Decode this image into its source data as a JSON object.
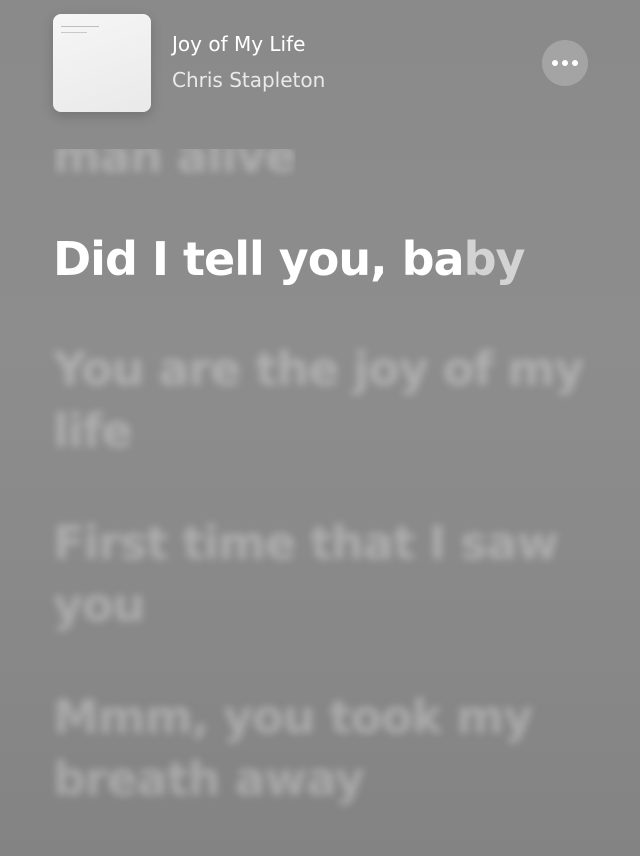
{
  "now_playing": {
    "title": "Joy of My Life",
    "artist": "Chris Stapleton",
    "more_button_icon": "ellipsis-icon"
  },
  "lyrics": {
    "previous": "man alive",
    "current_sung": "Did I tell you, ba",
    "current_unsung": "by",
    "upcoming": [
      "You are the joy of my life",
      "First time that I saw you",
      "Mmm, you took my breath away"
    ]
  },
  "colors": {
    "background": "#8a8a8a",
    "active_lyric": "#ffffff"
  }
}
